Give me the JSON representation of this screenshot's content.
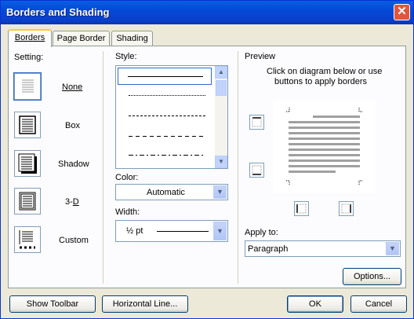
{
  "window": {
    "title": "Borders and Shading",
    "close_glyph": "✕"
  },
  "tabs": [
    {
      "label": "Borders"
    },
    {
      "label": "Page Border"
    },
    {
      "label": "Shading"
    }
  ],
  "setting": {
    "label": "Setting:",
    "items": [
      {
        "label": "None",
        "icon": "setting-none-icon"
      },
      {
        "label": "Box",
        "icon": "setting-box-icon"
      },
      {
        "label": "Shadow",
        "icon": "setting-shadow-icon"
      },
      {
        "label": "3-D",
        "icon": "setting-3d-icon"
      },
      {
        "label": "Custom",
        "icon": "setting-custom-icon"
      }
    ]
  },
  "style": {
    "label": "Style:"
  },
  "color": {
    "label": "Color:",
    "value": "Automatic"
  },
  "width": {
    "label": "Width:",
    "value": "½ pt"
  },
  "preview": {
    "label": "Preview",
    "hint_line1": "Click on diagram below or use",
    "hint_line2": "buttons to apply borders"
  },
  "apply_to": {
    "label": "Apply to:",
    "value": "Paragraph"
  },
  "buttons": {
    "options": "Options...",
    "show_toolbar": "Show Toolbar",
    "horizontal_line": "Horizontal Line...",
    "ok": "OK",
    "cancel": "Cancel"
  },
  "colors": {
    "titlebar": "#0a5fe0",
    "dialog_bg": "#ece9d8",
    "tab_highlight": "#ffc83c",
    "selection": "#316ac5"
  }
}
